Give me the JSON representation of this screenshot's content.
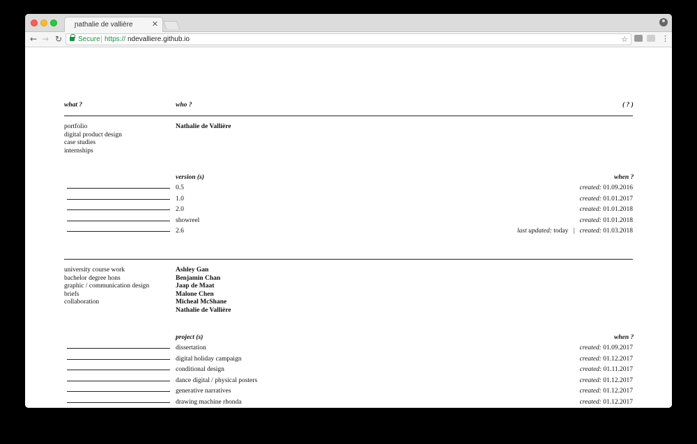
{
  "browser": {
    "tab_title": "ɲathalie de vallière",
    "secure_label": "Secure",
    "url_scheme": "https://",
    "url_host": "ndevalliere.github.io",
    "icons": [
      "back-arrow-icon",
      "forward-arrow-icon",
      "reload-icon",
      "lock-icon",
      "star-icon",
      "camera-icon",
      "cast-icon",
      "menu-icon",
      "profile-icon"
    ]
  },
  "header": {
    "what": "what ?",
    "who": "who ?",
    "help": "( ? )"
  },
  "section1": {
    "what_items": [
      "portfolio",
      "digital product design",
      "case studies",
      "internships"
    ],
    "who_items": [
      "Nathalie de Vallière"
    ],
    "versions_header": "version (s)",
    "when_header": "when ?",
    "versions": [
      {
        "name": "0.5",
        "created_label": "created:",
        "date": "01.09.2016"
      },
      {
        "name": "1.0",
        "created_label": "created:",
        "date": "01.01.2017"
      },
      {
        "name": "2.0",
        "created_label": "created:",
        "date": "01.01.2018"
      },
      {
        "name": "showreel",
        "created_label": "created:",
        "date": "01.01.2018"
      },
      {
        "name": "2.6",
        "updated_label": "last updated:",
        "updated_value": "today",
        "separator": "|",
        "created_label": "created:",
        "date": "01.03.2018"
      }
    ]
  },
  "section2": {
    "what_items": [
      "university course work",
      "bachelor degree hons",
      "graphic / communication design",
      "briefs",
      "collaboration"
    ],
    "who_items": [
      "Ashley Gan",
      "Benjamin Chan",
      "Jaap de Maat",
      "Malone Chen",
      "Micheal McShane",
      "Nathalie de Vallière"
    ],
    "projects_header": "project (s)",
    "when_header": "when ?",
    "projects": [
      {
        "name": "dissertation",
        "created_label": "created:",
        "date": "01.09.2017"
      },
      {
        "name": "digital holiday campaign",
        "created_label": "created:",
        "date": "01.12.2017"
      },
      {
        "name": "conditional design",
        "created_label": "created:",
        "date": "01.11.2017"
      },
      {
        "name": "dance digital / physical posters",
        "created_label": "created:",
        "date": "01.12.2017"
      },
      {
        "name": "generative narratives",
        "created_label": "created:",
        "date": "01.12.2017"
      },
      {
        "name": "drawing machine rhonda",
        "created_label": "created:",
        "date": "01.12.2017"
      }
    ]
  }
}
